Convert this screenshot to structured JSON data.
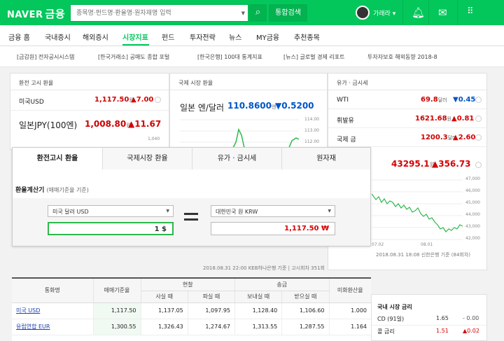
{
  "header": {
    "logo": "NAVER",
    "logo_sub": "금융",
    "search_placeholder": "종목명·펀드명·환율명·원자재명 입력",
    "search_button": "⌕",
    "total_search": "통합검색",
    "user_name": "가래라",
    "icons": [
      "bell-icon",
      "mail-icon",
      "grid-icon"
    ]
  },
  "nav": {
    "items": [
      "금융 홈",
      "국내증시",
      "해외증시",
      "시장지표",
      "펀드",
      "투자전략",
      "뉴스",
      "MY금융",
      "추천종목"
    ],
    "active": "시장지표"
  },
  "news_ticker": [
    "[금감원] 전자공시시스템",
    "[한국거래소] 공매도 종합 포털",
    "[한국은행] 100대 통계지표",
    "[뉴스] 글로벌 경제 리포트",
    "투자자보호 해외동향 2018-8"
  ],
  "panel_fx": {
    "title": "환전 고시 환율",
    "rows": [
      {
        "name": "미국USD",
        "value": "1,117.50",
        "unit": "원",
        "change": "▲7.00",
        "dir": "up"
      },
      {
        "name": "일본JPY(100엔)",
        "value": "1,008.80",
        "unit": "원",
        "change": "▲11.67",
        "dir": "up"
      }
    ]
  },
  "panel_intl": {
    "title": "국제 시장 환율",
    "name": "일본 엔/달러",
    "value": "110.8600",
    "unit": "엔",
    "change": "▼0.5200",
    "axis": [
      "114.00",
      "113.00",
      "112.00"
    ],
    "side_axis": "1,040"
  },
  "panel_oil": {
    "title": "유가 · 금시세",
    "rows": [
      {
        "name": "WTI",
        "value": "69.8",
        "unit": "달러",
        "change": "▼0.45",
        "dir": "down"
      },
      {
        "name": "휘발유",
        "value": "1621.68",
        "unit": "원",
        "change": "▲0.81",
        "dir": "up"
      },
      {
        "name": "국제 금",
        "value": "1200.3",
        "unit": "달러",
        "change": "▲2.60",
        "dir": "up"
      }
    ],
    "gold_value": "43295.1",
    "gold_unit": "원",
    "gold_change": "▲356.73",
    "axis": [
      "47,000",
      "46,000",
      "45,000",
      "44,000",
      "43,000",
      "42,000"
    ],
    "x_labels": [
      "07.02",
      "08.01"
    ],
    "footnote": "2018.08.31 18:08 신한은행 기준 (84회차)"
  },
  "layer": {
    "tabs": [
      "환전고시 환율",
      "국제시장 환율",
      "유가 · 금시세",
      "원자재"
    ],
    "active_tab": 0,
    "calc_title": "환율계산기",
    "calc_sub": "(매매기준율 기준)",
    "from_currency": "미국 달러 USD",
    "from_amount": "1 $",
    "to_currency": "대한민국 원 KRW",
    "to_amount": "1,117.50 ₩"
  },
  "meta": "2018.08.31 22:00  KEB하나은행 기준 | 고시회차 351회",
  "table": {
    "headers_top": [
      "통화명",
      "매매기준율",
      "현찰",
      "송금",
      "미화환산율"
    ],
    "headers_sub": [
      "사실 때",
      "파실 때",
      "보내실 때",
      "받으실 때"
    ],
    "rows": [
      {
        "name": "미국 USD",
        "base": "1,117.50",
        "buy": "1,137.05",
        "sell": "1,097.95",
        "send": "1,128.40",
        "recv": "1,106.60",
        "usd": "1.000"
      },
      {
        "name": "유럽연합 EUR",
        "base": "1,300.55",
        "buy": "1,326.43",
        "sell": "1,274.67",
        "send": "1,313.55",
        "recv": "1,287.55",
        "usd": "1.164"
      }
    ]
  },
  "rates": {
    "title": "국내 시장 금리",
    "rows": [
      {
        "name": "CD (91일)",
        "value": "1.65",
        "change": "- 0.00",
        "dir": "flat"
      },
      {
        "name": "콜 금리",
        "value": "1.51",
        "change": "▲0.02",
        "dir": "up"
      }
    ]
  },
  "colors": {
    "brand": "#03c75a",
    "up": "#d60000",
    "down": "#0054c8"
  }
}
